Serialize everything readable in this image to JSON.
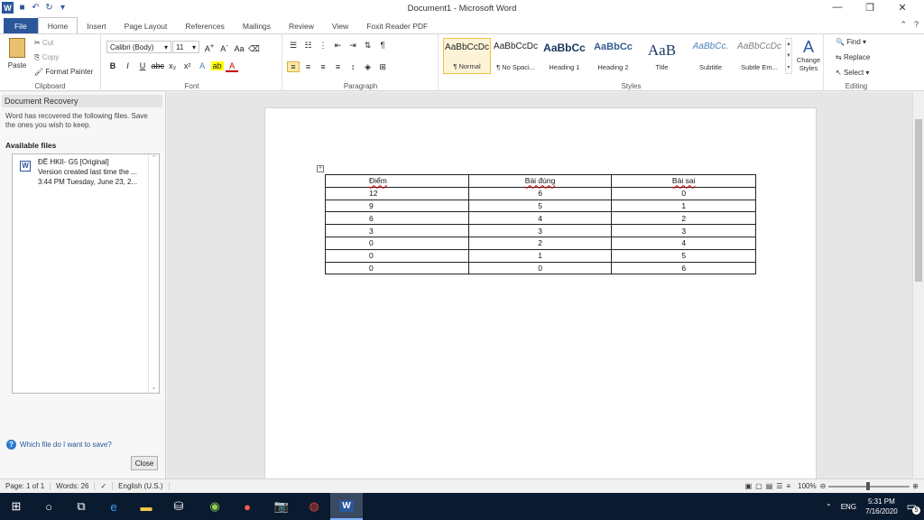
{
  "window": {
    "title": "Document1 - Microsoft Word",
    "min": "—",
    "max": "❐",
    "close": "✕"
  },
  "tabs": [
    "File",
    "Home",
    "Insert",
    "Page Layout",
    "References",
    "Mailings",
    "Review",
    "View",
    "Foxit Reader PDF"
  ],
  "ribbon": {
    "clipboard": {
      "label": "Clipboard",
      "paste": "Paste",
      "cut": "Cut",
      "copy": "Copy",
      "format_painter": "Format Painter"
    },
    "font": {
      "label": "Font",
      "family": "Calibri (Body)",
      "size": "11"
    },
    "paragraph": {
      "label": "Paragraph"
    },
    "styles": {
      "label": "Styles",
      "items": [
        {
          "preview": "AaBbCcDc",
          "name": "¶ Normal"
        },
        {
          "preview": "AaBbCcDc",
          "name": "¶ No Spaci..."
        },
        {
          "preview": "AaBbCc",
          "name": "Heading 1"
        },
        {
          "preview": "AaBbCc",
          "name": "Heading 2"
        },
        {
          "preview": "AaB",
          "name": "Title"
        },
        {
          "preview": "AaBbCc.",
          "name": "Subtitle"
        },
        {
          "preview": "AaBbCcDc",
          "name": "Subtle Em..."
        }
      ],
      "change_styles": "Change Styles"
    },
    "editing": {
      "label": "Editing",
      "find": "Find",
      "replace": "Replace",
      "select": "Select"
    }
  },
  "recovery": {
    "title": "Document Recovery",
    "message": "Word has recovered the following files.  Save the ones you wish to keep.",
    "available": "Available files",
    "file": {
      "name": "ĐỀ HKII- G5  [Original]",
      "line2": "Version created last time the ...",
      "line3": "3:44 PM Tuesday, June 23, 2..."
    },
    "help": "Which file do I want to save?",
    "close": "Close"
  },
  "table": {
    "headers": [
      "Điểm",
      "Bài đúng",
      "Bài sai"
    ],
    "rows": [
      [
        "12",
        "6",
        "0"
      ],
      [
        "9",
        "5",
        "1"
      ],
      [
        "6",
        "4",
        "2"
      ],
      [
        "3",
        "3",
        "3"
      ],
      [
        "0",
        "2",
        "4"
      ],
      [
        "0",
        "1",
        "5"
      ],
      [
        "0",
        "0",
        "6"
      ]
    ]
  },
  "status": {
    "page": "Page: 1 of 1",
    "words": "Words: 26",
    "language": "English (U.S.)",
    "zoom": "100%"
  },
  "taskbar": {
    "lang": "ENG",
    "time": "5:31 PM",
    "date": "7/16/2020",
    "notif": "5"
  }
}
